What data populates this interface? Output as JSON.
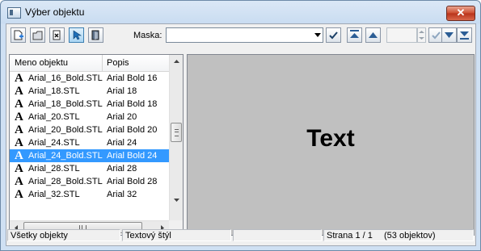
{
  "window": {
    "title": "Výber objektu",
    "close_label": "✕"
  },
  "toolbar": {
    "buttons": [
      "new-object",
      "open-object",
      "delete-object",
      "select-pointer",
      "exit-door"
    ],
    "mask_label": "Maska:",
    "mask_value": "",
    "nav_buttons": [
      "confirm",
      "first",
      "previous",
      "number-input",
      "spin",
      "apply",
      "next",
      "last"
    ]
  },
  "list": {
    "columns": [
      "Meno objektu",
      "Popis"
    ],
    "rows": [
      {
        "name": "Arial_16_Bold.STL",
        "desc": "Arial Bold 16",
        "selected": false
      },
      {
        "name": "Arial_18.STL",
        "desc": "Arial 18",
        "selected": false
      },
      {
        "name": "Arial_18_Bold.STL",
        "desc": "Arial Bold 18",
        "selected": false
      },
      {
        "name": "Arial_20.STL",
        "desc": "Arial 20",
        "selected": false
      },
      {
        "name": "Arial_20_Bold.STL",
        "desc": "Arial Bold 20",
        "selected": false
      },
      {
        "name": "Arial_24.STL",
        "desc": "Arial 24",
        "selected": false
      },
      {
        "name": "Arial_24_Bold.STL",
        "desc": "Arial Bold 24",
        "selected": true
      },
      {
        "name": "Arial_28.STL",
        "desc": "Arial 28",
        "selected": false
      },
      {
        "name": "Arial_28_Bold.STL",
        "desc": "Arial Bold 28",
        "selected": false
      },
      {
        "name": "Arial_32.STL",
        "desc": "Arial 32",
        "selected": false
      }
    ],
    "row_icon": "A"
  },
  "preview": {
    "text": "Text"
  },
  "status": {
    "filter": "Všetky objekty",
    "type": "Textový štýl",
    "empty": "",
    "page": "Strana  1 / 1",
    "count": "(53 objektov)"
  },
  "colors": {
    "selection": "#3399ff",
    "preview_bg": "#c0c0c0",
    "close": "#c7432a"
  }
}
